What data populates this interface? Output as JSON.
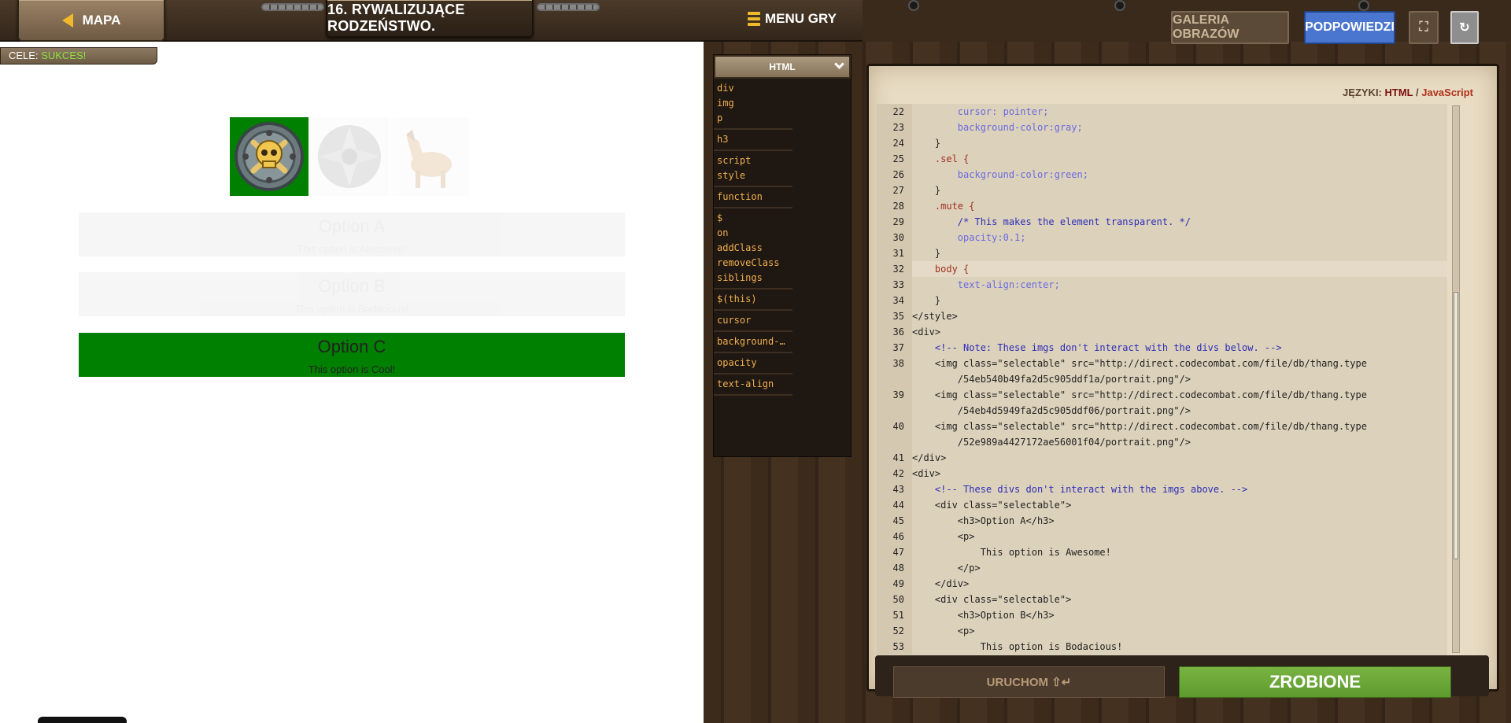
{
  "header": {
    "map_label": "MAPA",
    "level_title": "16. RYWALIZUJĄCE RODZEŃSTWO.",
    "menu_label": "MENU GRY"
  },
  "goals": {
    "label": "CELE:",
    "status": "SUKCES!"
  },
  "preview": {
    "options": [
      {
        "title": "Option A",
        "text": "This option is Awesome!"
      },
      {
        "title": "Option B",
        "text": "This option is Bodacious!"
      },
      {
        "title": "Option C",
        "text": "This option is Cool!"
      }
    ]
  },
  "snippets": {
    "header": "HTML",
    "groups": [
      [
        "div",
        "img",
        "p"
      ],
      [
        "h3"
      ],
      [
        "script",
        "style"
      ],
      [
        "function"
      ],
      [
        "$",
        "on",
        "addClass",
        "removeClass",
        "siblings"
      ],
      [
        "$(this)"
      ],
      [
        "cursor"
      ],
      [
        "background-…"
      ],
      [
        "opacity"
      ],
      [
        "text-align"
      ]
    ]
  },
  "editor": {
    "languages_label": "JĘZYKI:",
    "lang_html": "HTML",
    "lang_sep": " / ",
    "lang_js": "JavaScript",
    "lines": [
      {
        "n": "22",
        "t": "        cursor: pointer;"
      },
      {
        "n": "23",
        "t": "        background-color:gray;"
      },
      {
        "n": "24",
        "t": "    }"
      },
      {
        "n": "25",
        "t": "    .sel {"
      },
      {
        "n": "26",
        "t": "        background-color:green;"
      },
      {
        "n": "27",
        "t": "    }"
      },
      {
        "n": "28",
        "t": "    .mute {"
      },
      {
        "n": "29",
        "t": "        /* This makes the element transparent. */"
      },
      {
        "n": "30",
        "t": "        opacity:0.1;"
      },
      {
        "n": "31",
        "t": "    }"
      },
      {
        "n": "32",
        "t": "    body {"
      },
      {
        "n": "33",
        "t": "        text-align:center;"
      },
      {
        "n": "34",
        "t": "    }"
      },
      {
        "n": "35",
        "t": "</style>"
      },
      {
        "n": "36",
        "t": "<div>"
      },
      {
        "n": "37",
        "t": "    <!-- Note: These imgs don't interact with the divs below. -->"
      },
      {
        "n": "38",
        "t": "    <img class=\"selectable\" src=\"http://direct.codecombat.com/file/db/thang.type\n        /54eb540b49fa2d5c905ddf1a/portrait.png\"/>"
      },
      {
        "n": "39",
        "t": "    <img class=\"selectable\" src=\"http://direct.codecombat.com/file/db/thang.type\n        /54eb4d5949fa2d5c905ddf06/portrait.png\"/>"
      },
      {
        "n": "40",
        "t": "    <img class=\"selectable\" src=\"http://direct.codecombat.com/file/db/thang.type\n        /52e989a4427172ae56001f04/portrait.png\"/>"
      },
      {
        "n": "41",
        "t": "</div>"
      },
      {
        "n": "42",
        "t": "<div>"
      },
      {
        "n": "43",
        "t": "    <!-- These divs don't interact with the imgs above. -->"
      },
      {
        "n": "44",
        "t": "    <div class=\"selectable\">"
      },
      {
        "n": "45",
        "t": "        <h3>Option A</h3>"
      },
      {
        "n": "46",
        "t": "        <p>"
      },
      {
        "n": "47",
        "t": "            This option is Awesome!"
      },
      {
        "n": "48",
        "t": "        </p>"
      },
      {
        "n": "49",
        "t": "    </div>"
      },
      {
        "n": "50",
        "t": "    <div class=\"selectable\">"
      },
      {
        "n": "51",
        "t": "        <h3>Option B</h3>"
      },
      {
        "n": "52",
        "t": "        <p>"
      },
      {
        "n": "53",
        "t": "            This option is Bodacious!"
      }
    ]
  },
  "buttons": {
    "run": "URUCHOM ⇧↵",
    "done": "ZROBIONE",
    "gallery": "GALERIA OBRAZÓW",
    "hints": "PODPOWIEDZI",
    "fullscreen": "⛶",
    "reload": "↻"
  },
  "colors": {
    "accent": "#f0b92b",
    "success": "#008000",
    "hints": "#4a76cf",
    "done": "#6ba638"
  }
}
